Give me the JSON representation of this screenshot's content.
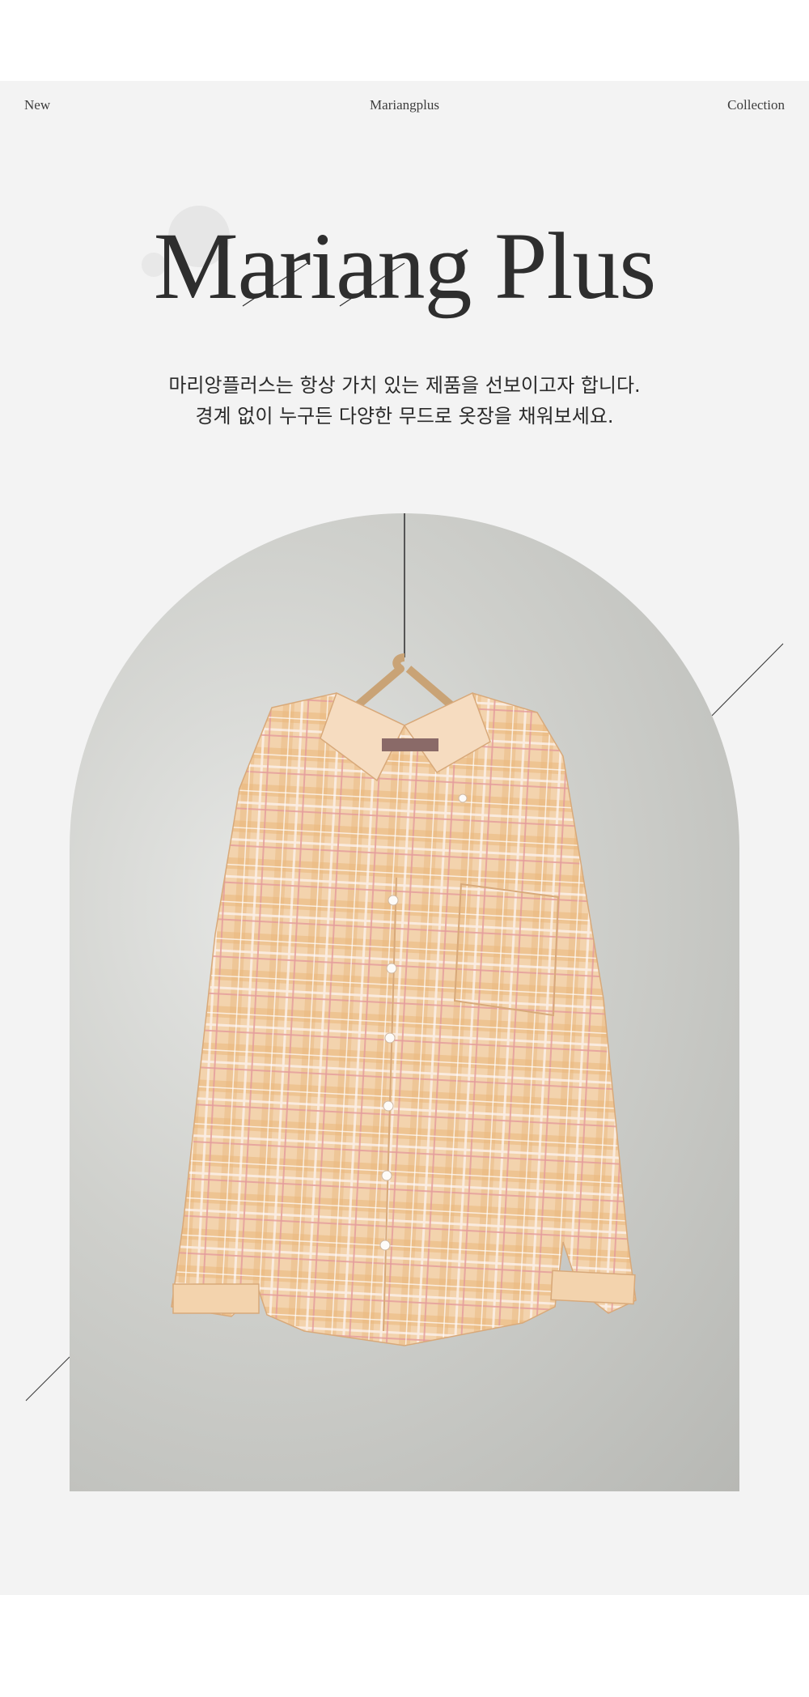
{
  "nav": {
    "left": "New",
    "center": "Mariangplus",
    "right": "Collection"
  },
  "brand": {
    "title": "Mariang Plus"
  },
  "tagline": {
    "line1": "마리앙플러스는 항상 가치 있는 제품을 선보이고자 합니다.",
    "line2": "경계 없이 누구든 다양한 무드로 옷장을 채워보세요."
  },
  "product": {
    "image": "plaid-shirt-on-hanger",
    "colors": {
      "background_arch": "#c4c5c1",
      "shirt_base": "#f2cfa8",
      "plaid_orange": "#e3a86a",
      "plaid_pink": "#e5a0a0",
      "hanger_wood": "#d7b48a"
    }
  }
}
